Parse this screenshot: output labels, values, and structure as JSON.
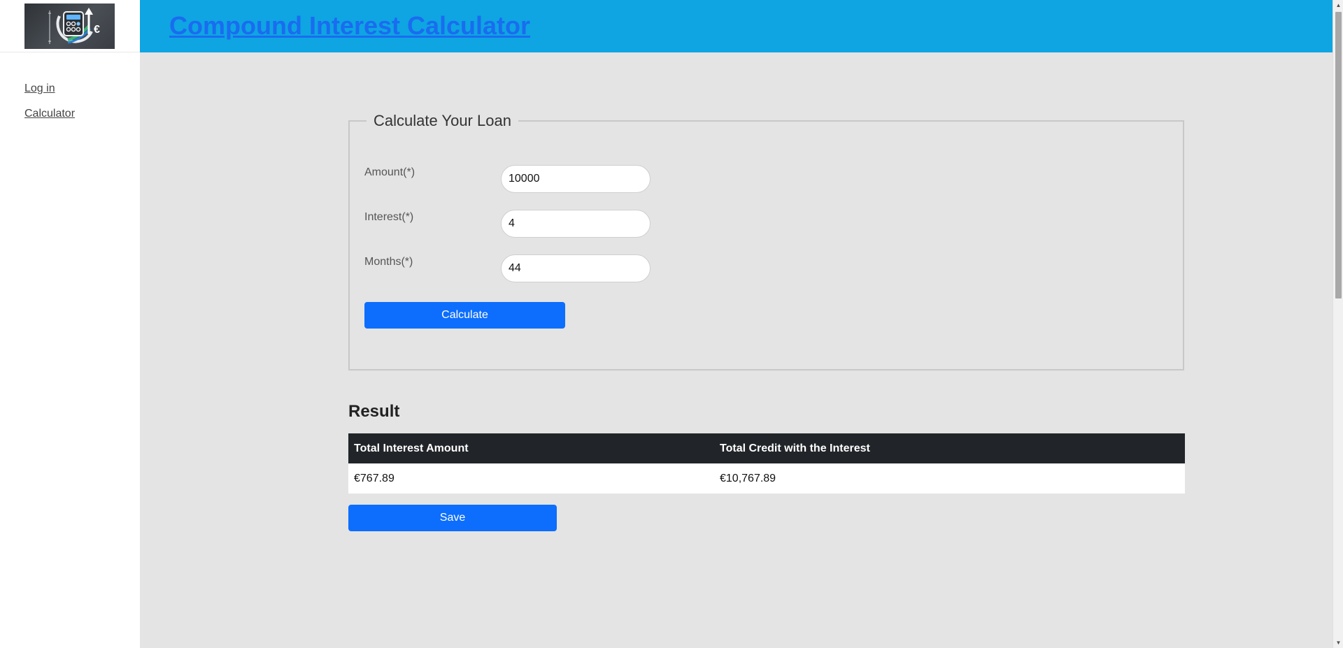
{
  "header": {
    "title": "Compound Interest Calculator"
  },
  "logo": {
    "icon": "calculator-euro-growth-logo",
    "euro_glyph": "€"
  },
  "sidebar": {
    "items": [
      {
        "label": "Log in"
      },
      {
        "label": "Calculator"
      }
    ]
  },
  "form": {
    "legend": "Calculate Your Loan",
    "fields": [
      {
        "label": "Amount(*)",
        "value": "10000"
      },
      {
        "label": "Interest(*)",
        "value": "4"
      },
      {
        "label": "Months(*)",
        "value": "44"
      }
    ],
    "calculate_label": "Calculate"
  },
  "result": {
    "title": "Result",
    "columns": [
      "Total Interest Amount",
      "Total Credit with the Interest"
    ],
    "rows": [
      [
        "€767.89",
        "€10,767.89"
      ]
    ],
    "save_label": "Save"
  },
  "colors": {
    "header_bg": "#0ea5e2",
    "title_link": "#1a6cf0",
    "primary_button": "#0d6efd",
    "table_header_bg": "#212529",
    "content_bg": "#e4e4e4"
  }
}
